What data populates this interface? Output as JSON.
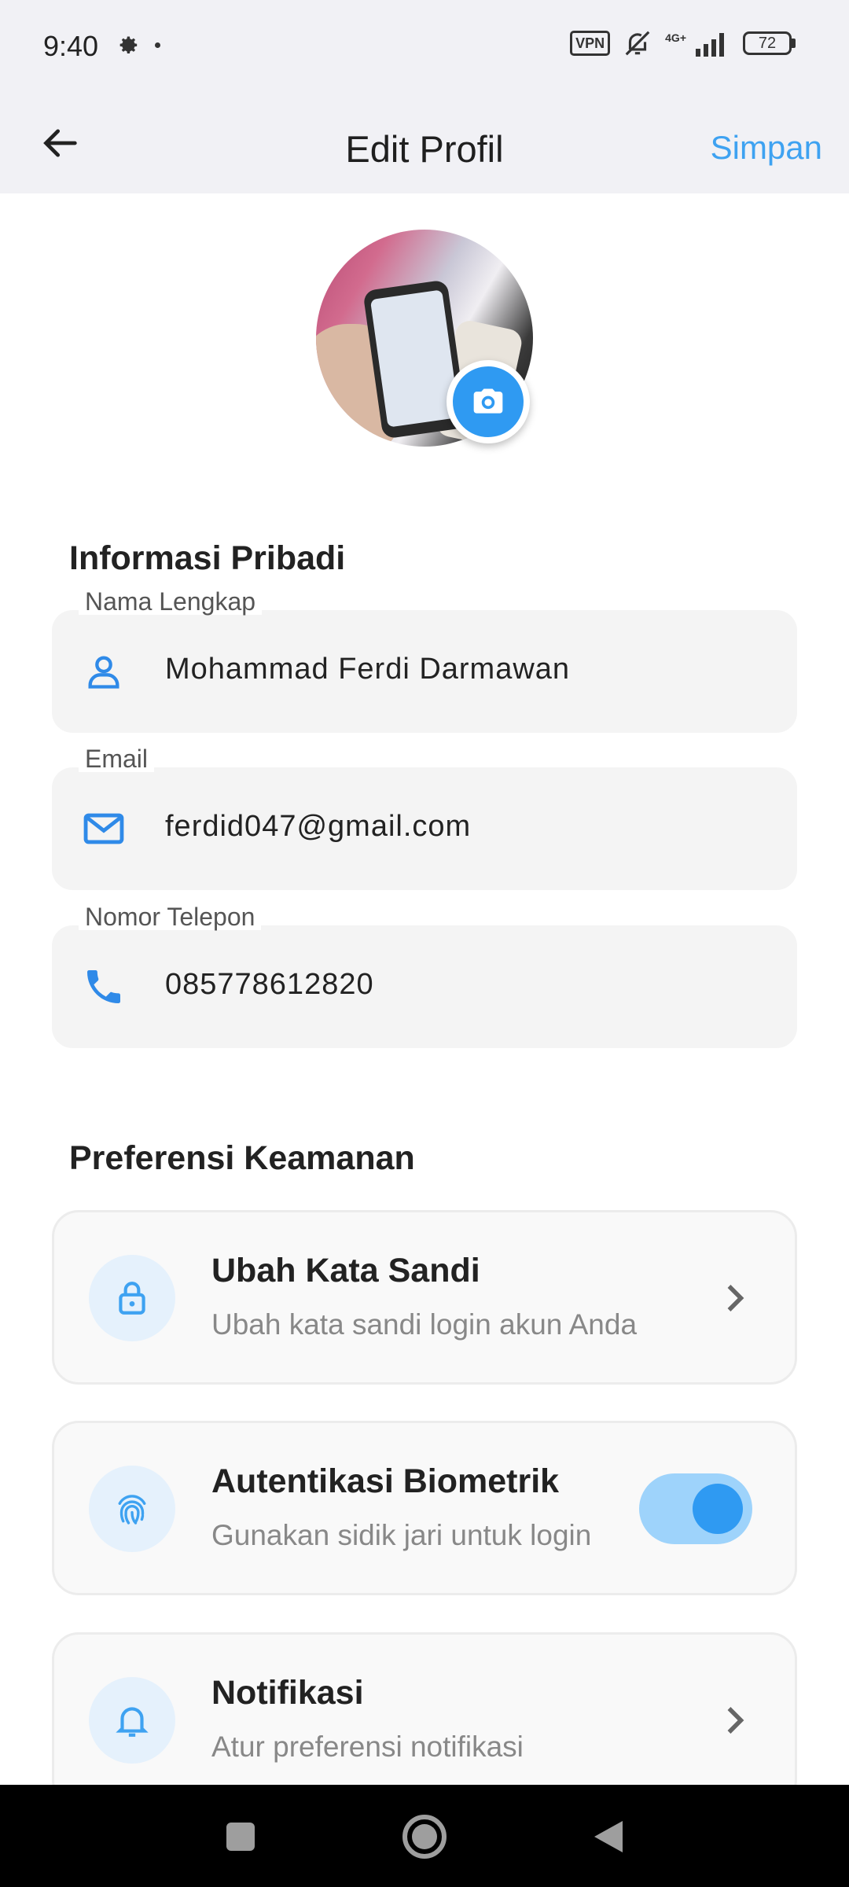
{
  "status_bar": {
    "time": "9:40",
    "vpn": "VPN",
    "network": "4G+",
    "battery": "72"
  },
  "app_bar": {
    "title": "Edit Profil",
    "save_label": "Simpan"
  },
  "personal_info": {
    "section_title": "Informasi Pribadi",
    "fields": [
      {
        "label": "Nama Lengkap",
        "value": "Mohammad Ferdi Darmawan",
        "icon": "person-icon"
      },
      {
        "label": "Email",
        "value": "ferdid047@gmail.com",
        "icon": "mail-icon"
      },
      {
        "label": "Nomor Telepon",
        "value": "085778612820",
        "icon": "phone-icon"
      }
    ]
  },
  "security": {
    "section_title": "Preferensi Keamanan",
    "items": [
      {
        "title": "Ubah Kata Sandi",
        "subtitle": "Ubah kata sandi login akun Anda",
        "icon": "lock-icon",
        "control": "chevron"
      },
      {
        "title": "Autentikasi Biometrik",
        "subtitle": "Gunakan sidik jari untuk login",
        "icon": "fingerprint-icon",
        "control": "toggle",
        "enabled": true
      },
      {
        "title": "Notifikasi",
        "subtitle": "Atur preferensi notifikasi",
        "icon": "bell-icon",
        "control": "chevron"
      }
    ]
  },
  "colors": {
    "accent": "#2f9af2",
    "accent_light": "#e5f1fc",
    "save_text": "#3ea2f1",
    "appbar_bg": "#f1f1f5"
  }
}
